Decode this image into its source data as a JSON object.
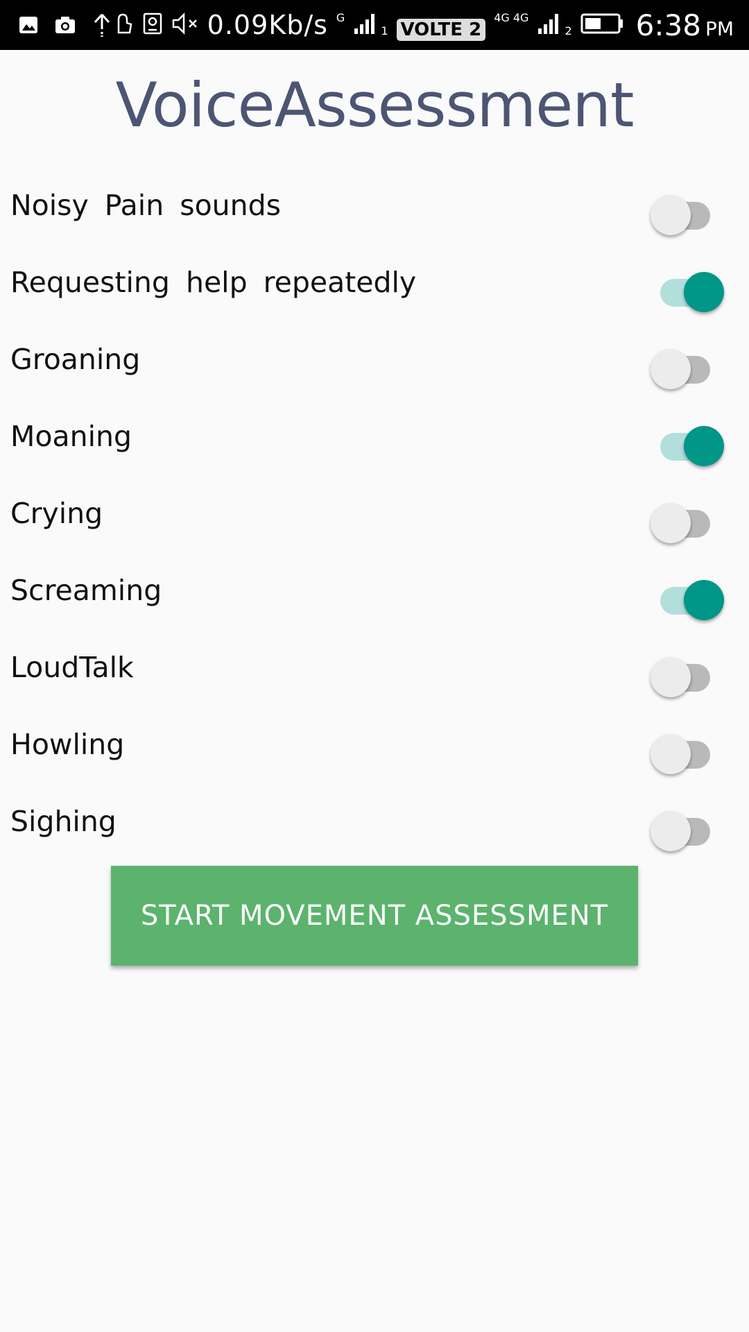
{
  "status_bar": {
    "net_speed": "0.09Kb/s",
    "sim1_type": "G",
    "sim1_index": "1",
    "volte": "VOLTE 2",
    "sim2_type": "4G 4G",
    "sim2_index": "2",
    "time": "6:38",
    "ampm": "PM",
    "icons": [
      "gallery-icon",
      "camera-icon",
      "upload-icon",
      "hand-icon",
      "id-icon",
      "mute-icon",
      "signal-icon",
      "battery-icon"
    ]
  },
  "header": {
    "title": "VoiceAssessment"
  },
  "options": [
    {
      "label": "Noisy Pain sounds",
      "checked": false
    },
    {
      "label": "Requesting help repeatedly",
      "checked": true
    },
    {
      "label": "Groaning",
      "checked": false
    },
    {
      "label": "Moaning",
      "checked": true
    },
    {
      "label": "Crying",
      "checked": false
    },
    {
      "label": "Screaming",
      "checked": true
    },
    {
      "label": "LoudTalk",
      "checked": false
    },
    {
      "label": "Howling",
      "checked": false
    },
    {
      "label": "Sighing",
      "checked": false
    }
  ],
  "start_button": {
    "label": "START MOVEMENT ASSESSMENT"
  },
  "colors": {
    "title": "#4d5574",
    "switch_on": "#009688",
    "switch_on_track": "#b2dfdb",
    "button": "#5cb36d"
  }
}
